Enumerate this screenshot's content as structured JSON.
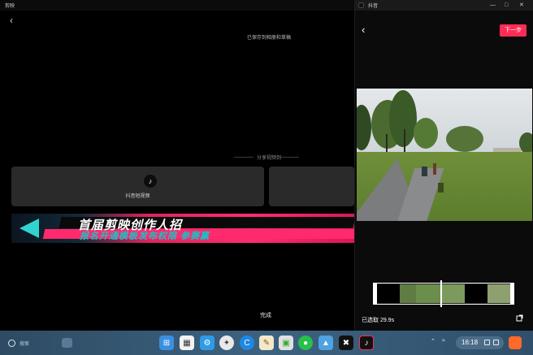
{
  "left_window": {
    "title": "剪映",
    "saved_text": "已保存到相册和草稿",
    "share_heading": "分享视频到",
    "share_targets": [
      {
        "label": "抖音短视频",
        "icon": "tiktok-icon"
      },
      {
        "label": ""
      }
    ],
    "banner": {
      "line1": "首届剪映创作人招",
      "line2": "报名开通模板发布权限 参赛赢"
    },
    "done_label": "完成"
  },
  "right_window": {
    "title": "抖音",
    "next_label": "下一步",
    "selected_text": "已选取 29.9s"
  },
  "taskbar": {
    "search_placeholder": "搜索",
    "time": "16:18",
    "accent": "#fe2c55"
  },
  "colors": {
    "next_button": "#fe2c55",
    "taskbar": "#3d6280"
  }
}
